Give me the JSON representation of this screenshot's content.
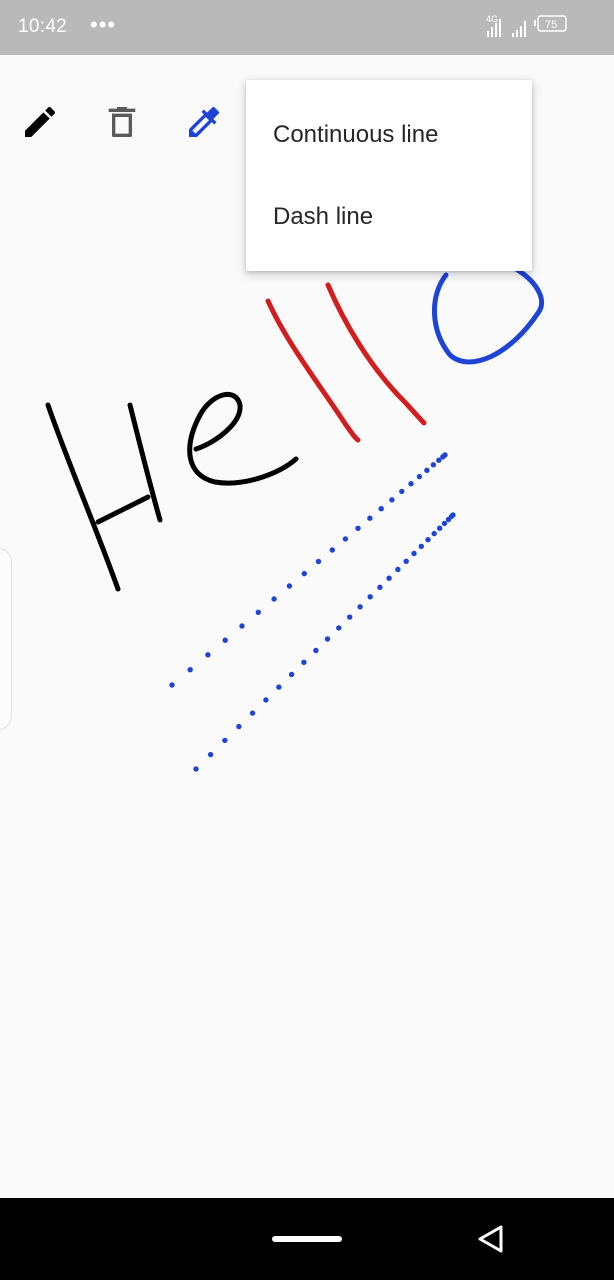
{
  "status_bar": {
    "time": "10:42",
    "dots": "•••",
    "network": "4G",
    "battery": "75"
  },
  "toolbar": {
    "pencil_icon": "pencil-icon",
    "trash_icon": "trash-icon",
    "picker_icon": "eyedropper-icon",
    "picker_color": "#1e44d6"
  },
  "menu": {
    "items": [
      {
        "label": "Continuous line"
      },
      {
        "label": "Dash line"
      }
    ]
  },
  "drawing": {
    "text_color": "#000000",
    "red_color": "#d21e1e",
    "blue_color": "#1e44d6"
  },
  "nav_bar": {
    "home_icon": "home-pill-icon",
    "back_icon": "back-triangle-icon"
  }
}
